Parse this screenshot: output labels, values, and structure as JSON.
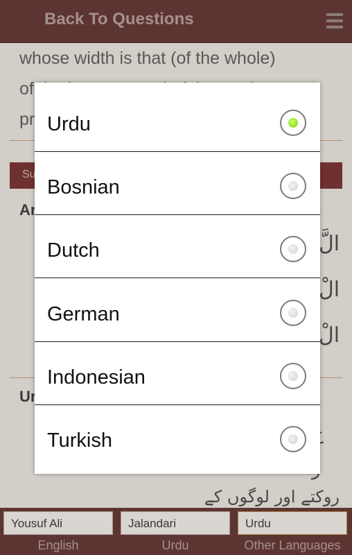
{
  "header": {
    "title": "Back To Questions",
    "menu_icon": "hamburger-menu-icon"
  },
  "background": {
    "verse_lines": [
      "whose width is that (of the whole)",
      "of the heavens and of the earth,",
      "pr"
    ],
    "section_bar_text": "Su",
    "label_a": "Ar",
    "arabic_glyphs": [
      "الَّ",
      "الْ",
      "الْ"
    ],
    "label_u": "Ur",
    "urdu_fragments": [
      "ج",
      "ر"
    ],
    "urdu_line": "روکتے اور لوگوں کے قصور معاف کرتے"
  },
  "dialog": {
    "options": [
      {
        "label": "Urdu",
        "selected": true
      },
      {
        "label": "Bosnian",
        "selected": false
      },
      {
        "label": "Dutch",
        "selected": false
      },
      {
        "label": "German",
        "selected": false
      },
      {
        "label": "Indonesian",
        "selected": false
      },
      {
        "label": "Turkish",
        "selected": false
      }
    ]
  },
  "footer": {
    "translations": [
      {
        "value": "Yousuf Ali",
        "caption": "English"
      },
      {
        "value": "Jalandari",
        "caption": "Urdu"
      },
      {
        "value": "Urdu",
        "caption": "Other Languages"
      }
    ]
  },
  "colors": {
    "header": "#5c3532",
    "radio_selected": "#8ee02a",
    "section_bar": "#6f3130"
  }
}
